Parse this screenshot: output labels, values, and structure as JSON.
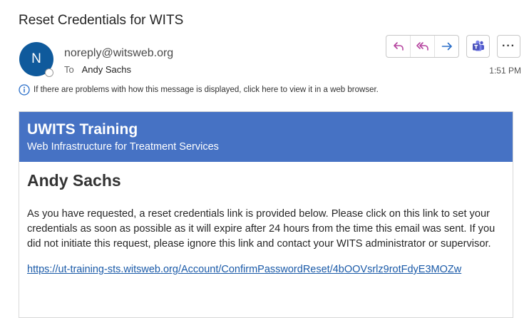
{
  "email": {
    "subject": "Reset Credentials for WITS",
    "sender": {
      "initial": "N",
      "address": "noreply@witsweb.org"
    },
    "to": {
      "label": "To",
      "recipient": "Andy Sachs"
    },
    "time": "1:51 PM",
    "info_message": "If there are problems with how this message is displayed, click here to view it in a web browser.",
    "toolbar": {
      "reply_icon": "reply-icon",
      "reply_all_icon": "reply-all-icon",
      "forward_icon": "forward-icon",
      "teams_icon": "teams-icon",
      "more_label": "···"
    },
    "body": {
      "banner_title": "UWITS Training",
      "banner_subtitle": "Web Infrastructure for Treatment Services",
      "banner_color": "#4672c4",
      "user_name": "Andy Sachs",
      "message": "As you have requested, a reset credentials link is provided below. Please click on this link to set your credentials as soon as possible as it will expire after 24 hours from the time this email was sent. If you did not initiate this request, please ignore this link and contact your WITS administrator or supervisor.",
      "link": "https://ut-training-sts.witsweb.org/Account/ConfirmPasswordReset/4bOOVsrlz9rotFdyE3MOZw"
    }
  }
}
